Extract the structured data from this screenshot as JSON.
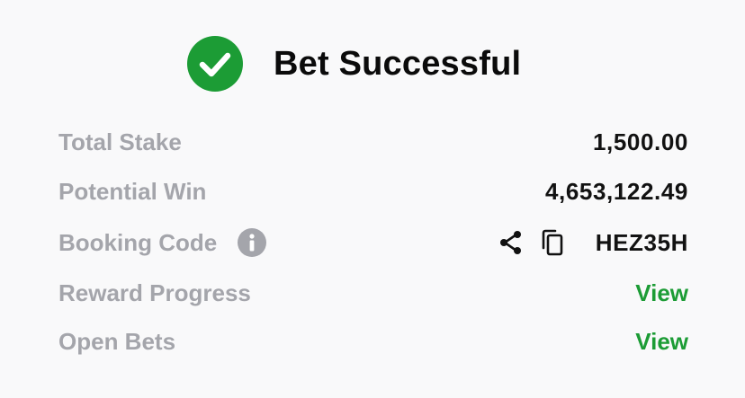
{
  "header": {
    "title": "Bet Successful",
    "icon": "check-circle-icon",
    "accent_color": "#1c9c35"
  },
  "rows": {
    "total_stake": {
      "label": "Total Stake",
      "value": "1,500.00"
    },
    "potential_win": {
      "label": "Potential Win",
      "value": "4,653,122.49"
    },
    "booking_code": {
      "label": "Booking Code",
      "info_icon": "info-icon",
      "share_icon": "share-icon",
      "copy_icon": "copy-icon",
      "value": "HEZ35H"
    },
    "reward_progress": {
      "label": "Reward Progress",
      "link": "View"
    },
    "open_bets": {
      "label": "Open Bets",
      "link": "View"
    }
  }
}
